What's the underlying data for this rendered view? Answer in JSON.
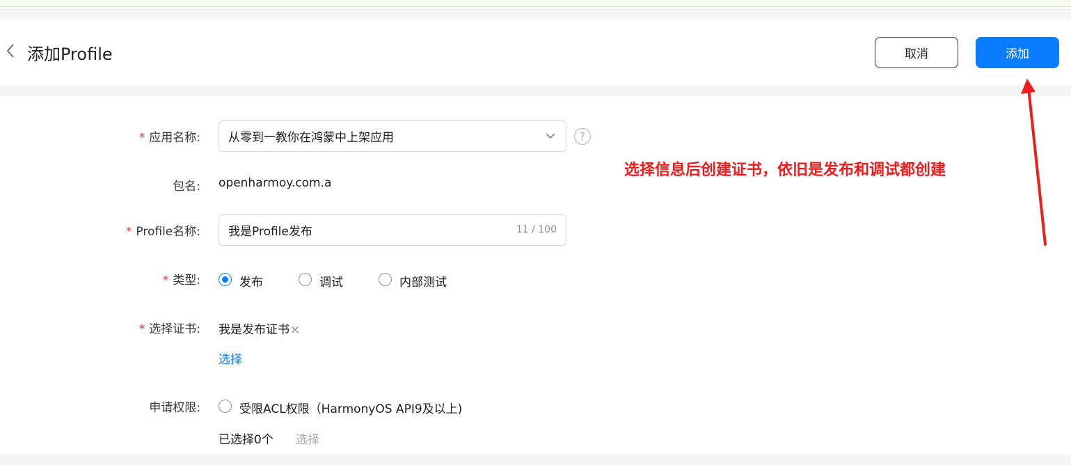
{
  "header": {
    "title": "添加Profile",
    "cancel_label": "取消",
    "add_label": "添加"
  },
  "form": {
    "app_name": {
      "label": "应用名称:",
      "required_mark": "*",
      "value": "从零到一教你在鸿蒙中上架应用",
      "help_glyph": "?"
    },
    "package": {
      "label": "包名:",
      "value": "openharmoy.com.a"
    },
    "profile_name": {
      "label": "Profile名称:",
      "required_mark": "*",
      "value": "我是Profile发布",
      "counter": "11 / 100"
    },
    "type": {
      "label": "类型:",
      "required_mark": "*",
      "options": [
        {
          "label": "发布",
          "checked": true
        },
        {
          "label": "调试",
          "checked": false
        },
        {
          "label": "内部测试",
          "checked": false
        }
      ]
    },
    "certificate": {
      "label": "选择证书:",
      "required_mark": "*",
      "selected": "我是发布证书",
      "remove_glyph": "×",
      "select_link": "选择"
    },
    "permissions": {
      "label": "申请权限:",
      "option_label": "受限ACL权限（HarmonyOS API9及以上)",
      "selected_count": "已选择0个",
      "select_link": "选择"
    }
  },
  "annotation": {
    "text": "选择信息后创建证书，依旧是发布和调试都创建",
    "color": "#f01c1c"
  },
  "colors": {
    "accent": "#0a7cff",
    "required": "#e5322d"
  },
  "icons": {
    "back": "chevron-left-icon",
    "dropdown": "chevron-down-icon",
    "help": "help-circle-icon",
    "remove": "close-icon",
    "arrow": "red-arrow"
  }
}
